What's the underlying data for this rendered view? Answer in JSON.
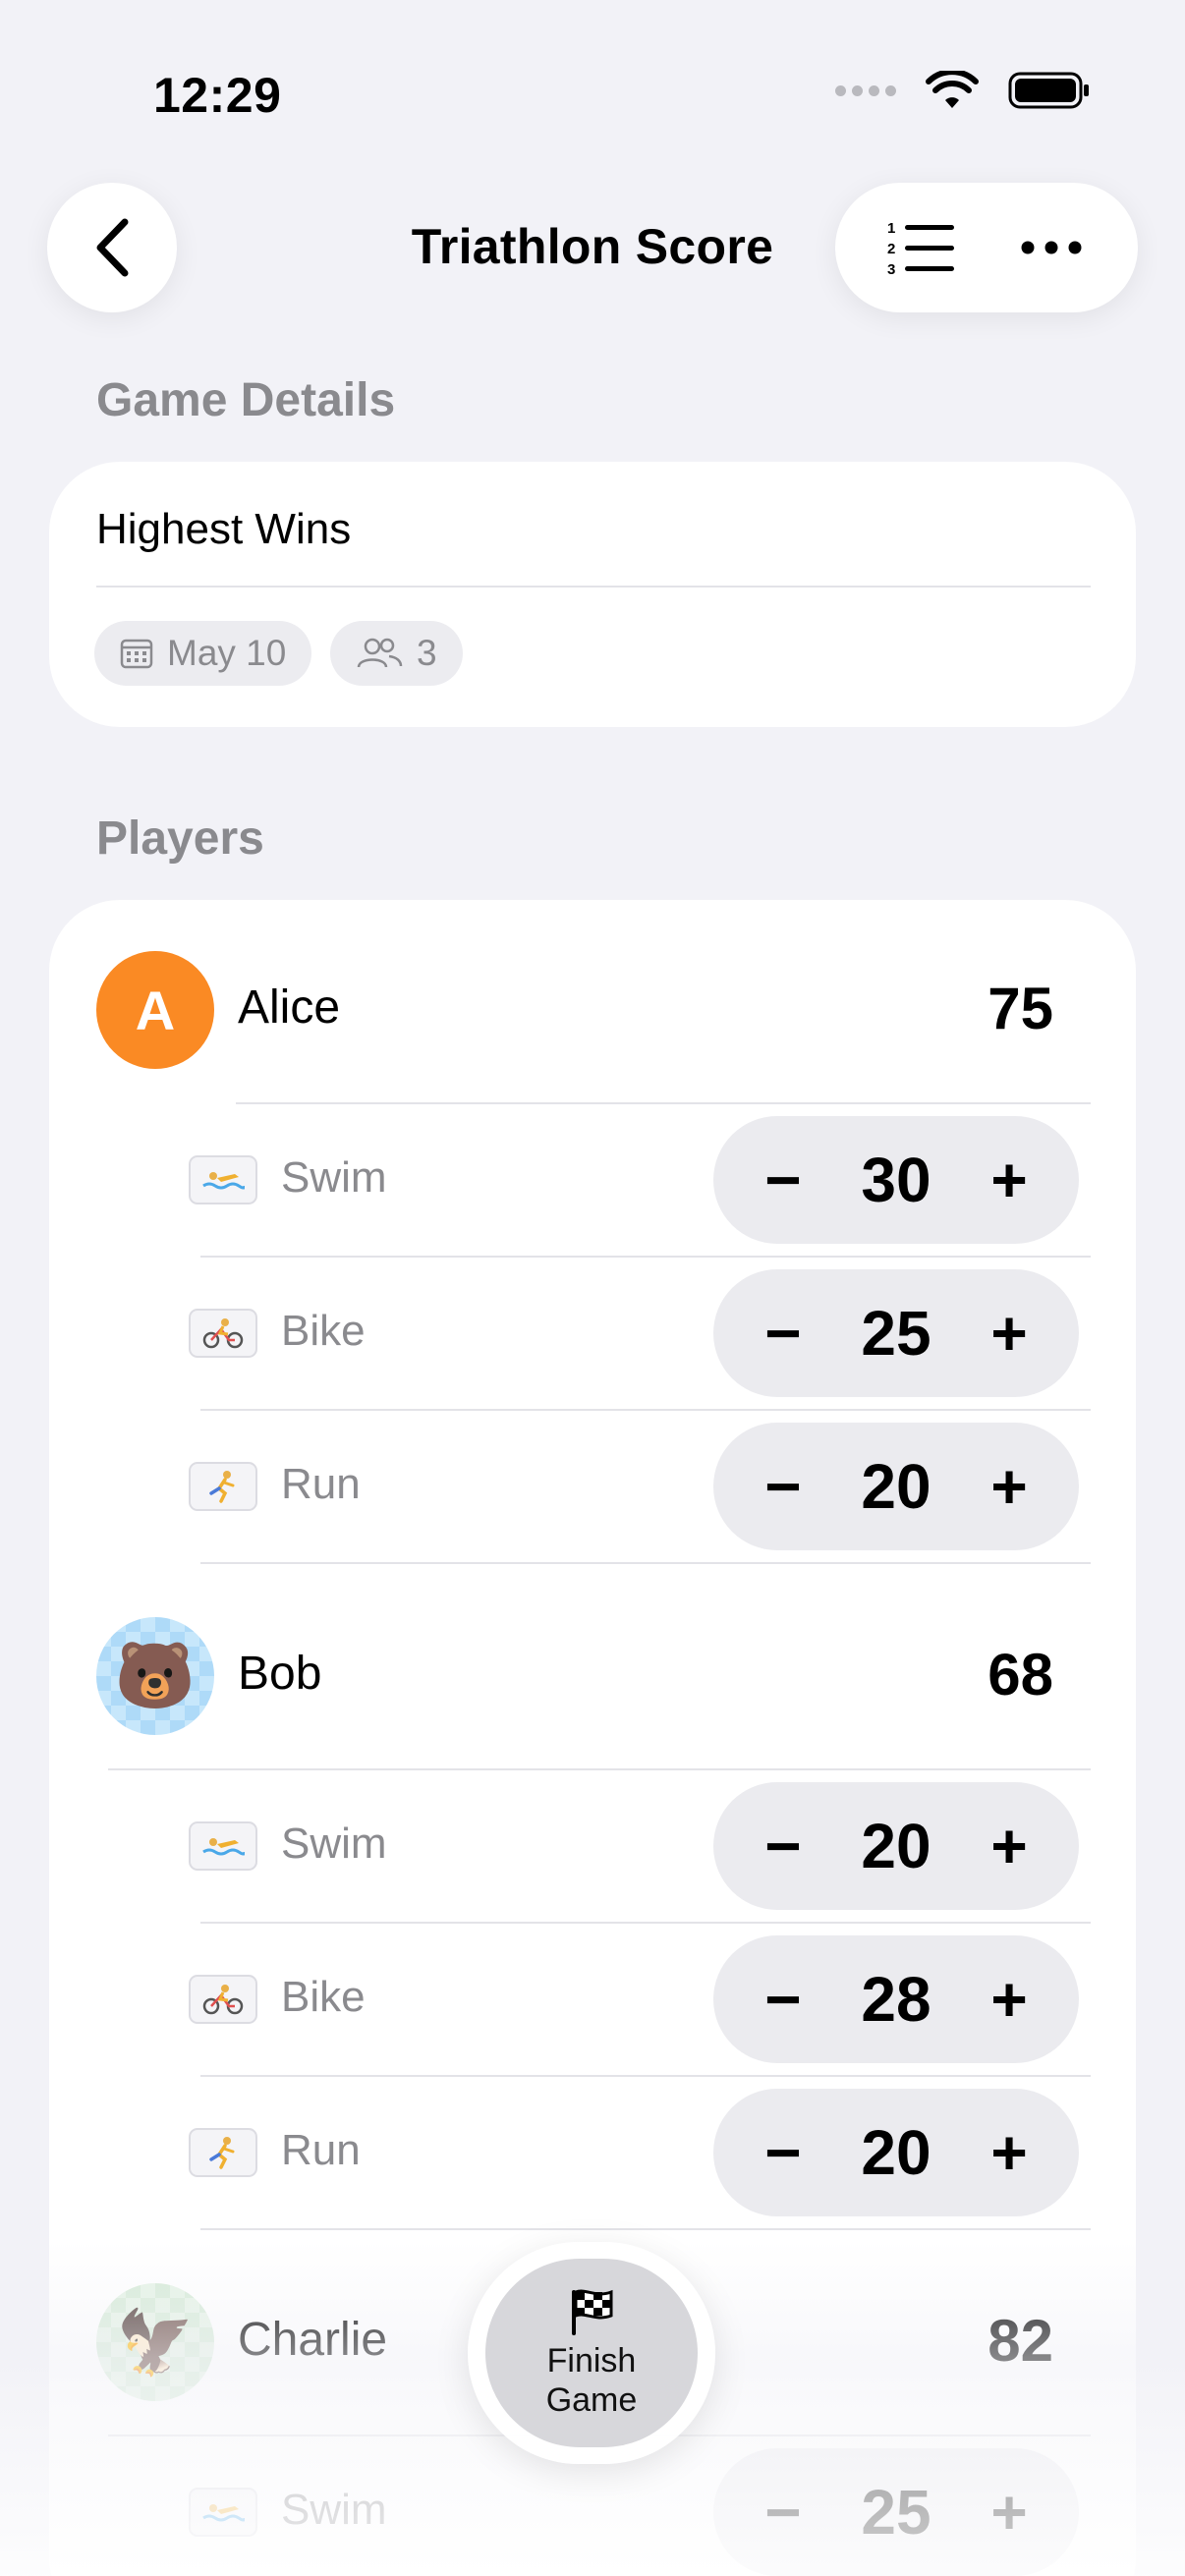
{
  "status_bar": {
    "time": "12:29"
  },
  "nav": {
    "title": "Triathlon Score"
  },
  "game_details": {
    "header": "Game Details",
    "mode": "Highest Wins",
    "date": "May 10",
    "player_count": "3"
  },
  "players_section": {
    "header": "Players"
  },
  "players": [
    {
      "name": "Alice",
      "avatar_letter": "A",
      "total": "75",
      "events": [
        {
          "label": "Swim",
          "value": "30"
        },
        {
          "label": "Bike",
          "value": "25"
        },
        {
          "label": "Run",
          "value": "20"
        }
      ]
    },
    {
      "name": "Bob",
      "avatar_emoji": "🐻",
      "total": "68",
      "events": [
        {
          "label": "Swim",
          "value": "20"
        },
        {
          "label": "Bike",
          "value": "28"
        },
        {
          "label": "Run",
          "value": "20"
        }
      ]
    },
    {
      "name": "Charlie",
      "avatar_emoji": "🦅",
      "total": "82",
      "events": [
        {
          "label": "Swim",
          "value": "25"
        }
      ]
    }
  ],
  "stepper_symbols": {
    "minus": "−",
    "plus": "+"
  },
  "finish_button": {
    "label": "Finish Game"
  },
  "colors": {
    "background": "#f2f2f7",
    "card": "#ffffff",
    "secondary_text": "#8a8a8e",
    "alice_avatar": "#fa8a24",
    "bob_avatar": "#aedaf8",
    "charlie_avatar": "#d6ebd8",
    "stepper_bg": "#ebebef"
  },
  "icons": {
    "back": "chevron-left-icon",
    "leaderboard": "numbered-list-icon",
    "more": "ellipsis-icon",
    "date": "calendar-icon",
    "players": "people-icon",
    "swim": "swimmer-icon",
    "bike": "cyclist-icon",
    "run": "runner-icon",
    "finish": "checkered-flag-icon"
  }
}
